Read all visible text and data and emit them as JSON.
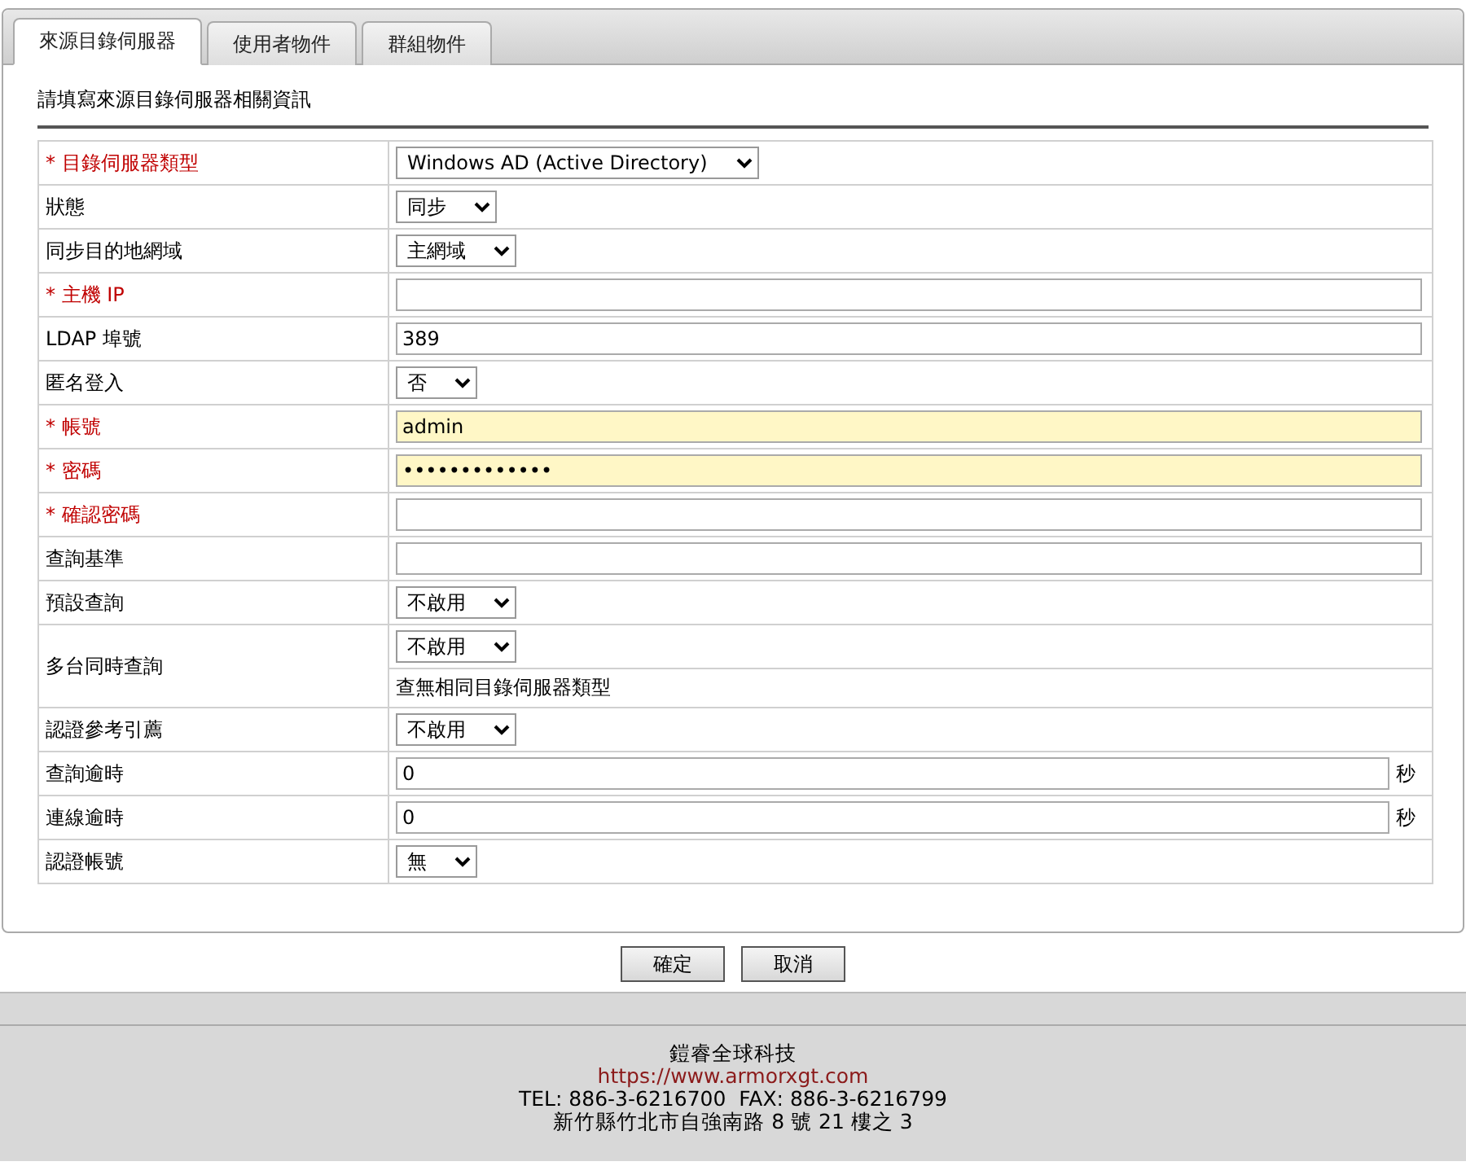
{
  "tabs": [
    {
      "label": "來源目錄伺服器",
      "selected": true
    },
    {
      "label": "使用者物件",
      "selected": false
    },
    {
      "label": "群組物件",
      "selected": false
    }
  ],
  "section_title": "請填寫來源目錄伺服器相關資訊",
  "form_rows": [
    {
      "label": "* 目錄伺服器類型",
      "required": true,
      "kind": "select",
      "value": "Windows AD (Active Directory)"
    },
    {
      "label": "狀態",
      "required": false,
      "kind": "select",
      "value": "同步"
    },
    {
      "label": "同步目的地網域",
      "required": false,
      "kind": "select",
      "value": "主網域"
    },
    {
      "label": "* 主機 IP",
      "required": true,
      "kind": "text"
    },
    {
      "label": "LDAP 埠號",
      "required": false,
      "kind": "text",
      "value": "389"
    },
    {
      "label": "匿名登入",
      "required": false,
      "kind": "select",
      "value": "否"
    },
    {
      "label": "* 帳號",
      "required": true,
      "kind": "text",
      "value": "admin",
      "highlighted": true
    },
    {
      "label": "* 密碼",
      "required": true,
      "kind": "text",
      "value": "•••••••••••••",
      "highlighted": true
    },
    {
      "label": "* 確認密碼",
      "required": true,
      "kind": "text"
    },
    {
      "label": "查詢基準",
      "required": false,
      "kind": "text"
    },
    {
      "label": "預設查詢",
      "required": false,
      "kind": "select",
      "value": "不啟用"
    },
    {
      "label": "多台同時查詢",
      "required": false,
      "kind": "select",
      "value": "不啟用",
      "note": "查無相同目錄伺服器類型"
    },
    {
      "label": "認證參考引薦",
      "required": false,
      "kind": "select",
      "value": "不啟用"
    },
    {
      "label": "查詢逾時",
      "required": false,
      "kind": "text",
      "value": "0",
      "unit": "秒"
    },
    {
      "label": "連線逾時",
      "required": false,
      "kind": "text",
      "value": "0",
      "unit": "秒"
    },
    {
      "label": "認證帳號",
      "required": false,
      "kind": "select",
      "value": "無"
    }
  ],
  "buttons": [
    "確定",
    "取消"
  ],
  "footer": {
    "company": "鎧睿全球科技",
    "url": "https://www.armorxgt.com",
    "contact": "TEL: 886-3-6216700  FAX: 886-3-6216799",
    "address": "新竹縣竹北市自強南路 8 號 21 樓之 3"
  }
}
